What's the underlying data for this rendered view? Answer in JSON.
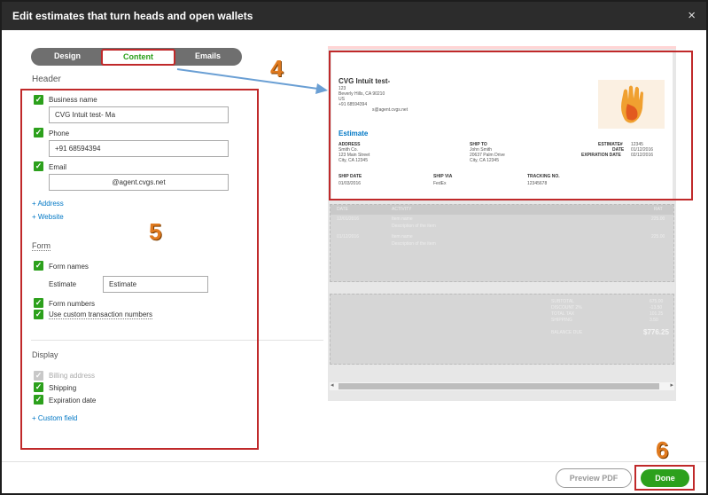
{
  "window": {
    "title": "Edit estimates that turn heads and open wallets",
    "close_glyph": "×"
  },
  "tabs": [
    {
      "label": "Design"
    },
    {
      "label": "Content",
      "active": true
    },
    {
      "label": "Emails"
    }
  ],
  "header_section": {
    "title": "Header",
    "business_name": {
      "label": "Business name",
      "checked": true,
      "value": "CVG Intuit test- Ma"
    },
    "phone": {
      "label": "Phone",
      "checked": true,
      "value": "+91 68594394"
    },
    "email": {
      "label": "Email",
      "checked": true,
      "value": "@agent.cvgs.net"
    },
    "links": {
      "address": "+ Address",
      "website": "+ Website"
    }
  },
  "form_section": {
    "title": "Form",
    "form_names": {
      "label": "Form names",
      "checked": true
    },
    "estimate_label": "Estimate",
    "estimate_value": "Estimate",
    "form_numbers": {
      "label": "Form numbers",
      "checked": true
    },
    "custom_numbers": {
      "label": "Use custom transaction numbers",
      "checked": true
    }
  },
  "display_section": {
    "title": "Display",
    "billing_address": {
      "label": "Billing address",
      "checked": true,
      "disabled": true
    },
    "shipping": {
      "label": "Shipping",
      "checked": true
    },
    "expiration_date": {
      "label": "Expiration date",
      "checked": true
    },
    "custom_field_link": "+ Custom field"
  },
  "preview": {
    "company": "CVG Intuit test-",
    "addr1": "123",
    "addr2": "Beverly Hills, CA 90210",
    "addr3": "US",
    "phone": "+91 68594394",
    "email": "s@agent.cvgs.net",
    "doc_title": "Estimate",
    "address_header": "ADDRESS",
    "address_lines": [
      "Smith Co.",
      "123 Main Street",
      "City, CA 12345"
    ],
    "shipto_header": "SHIP TO",
    "shipto_lines": [
      "John Smith",
      "20637 Palm Drive",
      "City, CA 12345"
    ],
    "meta_labels": [
      "ESTIMATE#",
      "DATE",
      "EXPIRATION DATE"
    ],
    "meta_values": [
      "12345",
      "01/12/2016",
      "02/12/2016"
    ],
    "ship_date_header": "SHIP DATE",
    "ship_date": "01/03/2016",
    "ship_via_header": "SHIP VIA",
    "ship_via": "FedEx",
    "tracking_header": "TRACKING NO.",
    "tracking": "12345678",
    "table_headers": {
      "date": "DATE",
      "activity": "ACTIVITY",
      "rate": "RAT"
    },
    "rows": [
      {
        "date": "12/01/2016",
        "activity": "Item name",
        "desc": "Description of the item",
        "amount": "225.00"
      },
      {
        "date": "01/12/2016",
        "activity": "Item name",
        "desc": "Description of the item",
        "amount": "225.00"
      }
    ],
    "totals_labels": [
      "SUBTOTAL",
      "DISCOUNT 2%",
      "TOTAL TAX",
      "SHIPPING"
    ],
    "totals_values": [
      "675.00",
      "-13.50",
      "101.25",
      "3.50"
    ],
    "balance_label": "BALANCE DUE",
    "balance_value": "$776.25"
  },
  "annotations": {
    "four": "4",
    "five": "5",
    "six": "6"
  },
  "buttons": {
    "preview_pdf": "Preview PDF",
    "done": "Done"
  },
  "colors": {
    "accent": "#2ca01c",
    "annotation": "#c0292a",
    "link": "#0077c5"
  }
}
